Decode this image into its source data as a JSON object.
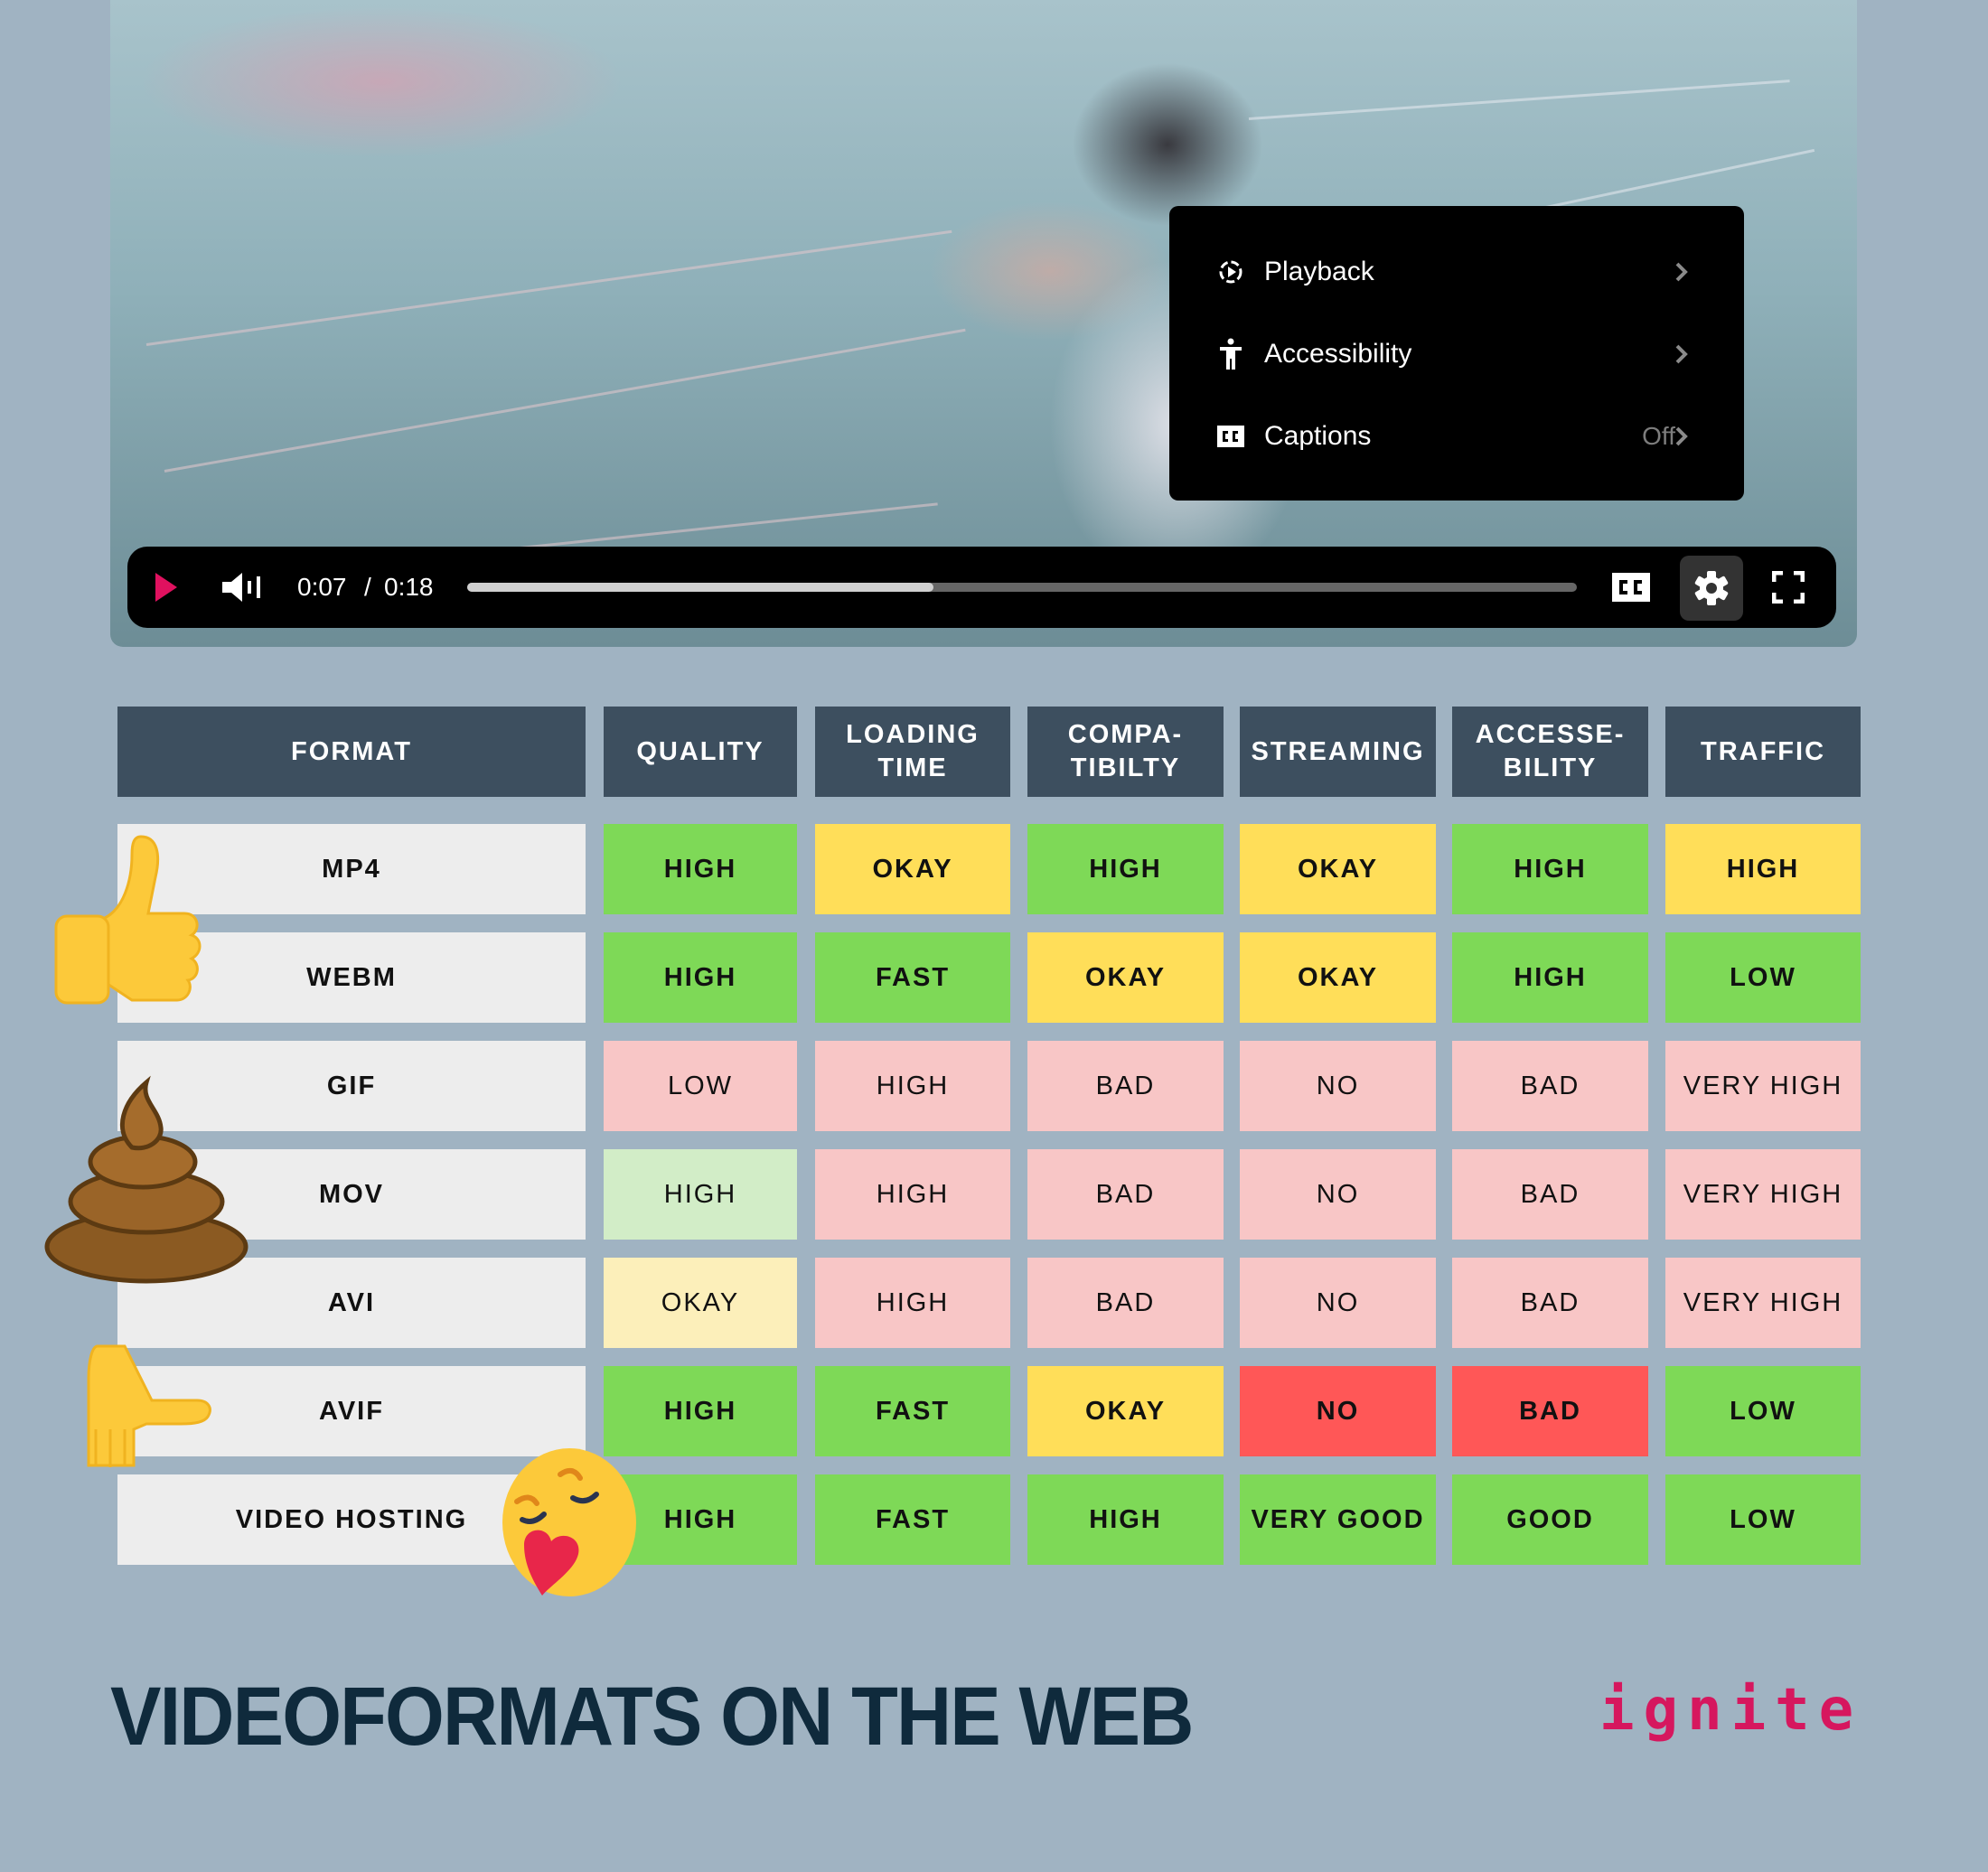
{
  "video": {
    "current_time": "0:07",
    "separator": "/",
    "duration": "0:18",
    "progress": 0.42,
    "accent_color": "#e0115f"
  },
  "settings_menu": {
    "items": [
      {
        "label": "Playback",
        "icon": "playback-icon",
        "value": ""
      },
      {
        "label": "Accessibility",
        "icon": "accessibility-icon",
        "value": ""
      },
      {
        "label": "Captions",
        "icon": "cc-icon",
        "value": "Off"
      }
    ]
  },
  "table": {
    "headers": [
      "FORMAT",
      "QUALITY",
      "LOADING\nTIME",
      "COMPA-\nTIBILTY",
      "STREAMING",
      "ACCESSE-\nBILITY",
      "TRAFFIC"
    ],
    "rows": [
      {
        "format": "MP4",
        "cells": [
          {
            "text": "HIGH",
            "color": "#7ed957",
            "bold": true
          },
          {
            "text": "OKAY",
            "color": "#ffde59",
            "bold": true
          },
          {
            "text": "HIGH",
            "color": "#7ed957",
            "bold": true
          },
          {
            "text": "OKAY",
            "color": "#ffde59",
            "bold": true
          },
          {
            "text": "HIGH",
            "color": "#7ed957",
            "bold": true
          },
          {
            "text": "HIGH",
            "color": "#ffde59",
            "bold": true
          }
        ]
      },
      {
        "format": "WEBM",
        "cells": [
          {
            "text": "HIGH",
            "color": "#7ed957",
            "bold": true
          },
          {
            "text": "FAST",
            "color": "#7ed957",
            "bold": true
          },
          {
            "text": "OKAY",
            "color": "#ffde59",
            "bold": true
          },
          {
            "text": "OKAY",
            "color": "#ffde59",
            "bold": true
          },
          {
            "text": "HIGH",
            "color": "#7ed957",
            "bold": true
          },
          {
            "text": "LOW",
            "color": "#7ed957",
            "bold": true
          }
        ]
      },
      {
        "format": "GIF",
        "cells": [
          {
            "text": "LOW",
            "color": "#f8c6c6",
            "bold": false
          },
          {
            "text": "HIGH",
            "color": "#f8c6c6",
            "bold": false
          },
          {
            "text": "BAD",
            "color": "#f8c6c6",
            "bold": false
          },
          {
            "text": "NO",
            "color": "#f8c6c6",
            "bold": false
          },
          {
            "text": "BAD",
            "color": "#f8c6c6",
            "bold": false
          },
          {
            "text": "VERY HIGH",
            "color": "#f8c6c6",
            "bold": false
          }
        ]
      },
      {
        "format": "MOV",
        "cells": [
          {
            "text": "HIGH",
            "color": "#d2edc7",
            "bold": false
          },
          {
            "text": "HIGH",
            "color": "#f8c6c6",
            "bold": false
          },
          {
            "text": "BAD",
            "color": "#f8c6c6",
            "bold": false
          },
          {
            "text": "NO",
            "color": "#f8c6c6",
            "bold": false
          },
          {
            "text": "BAD",
            "color": "#f8c6c6",
            "bold": false
          },
          {
            "text": "VERY HIGH",
            "color": "#f8c6c6",
            "bold": false
          }
        ]
      },
      {
        "format": "AVI",
        "cells": [
          {
            "text": "OKAY",
            "color": "#fcefba",
            "bold": false
          },
          {
            "text": "HIGH",
            "color": "#f8c6c6",
            "bold": false
          },
          {
            "text": "BAD",
            "color": "#f8c6c6",
            "bold": false
          },
          {
            "text": "NO",
            "color": "#f8c6c6",
            "bold": false
          },
          {
            "text": "BAD",
            "color": "#f8c6c6",
            "bold": false
          },
          {
            "text": "VERY HIGH",
            "color": "#f8c6c6",
            "bold": false
          }
        ]
      },
      {
        "format": "AVIF",
        "cells": [
          {
            "text": "HIGH",
            "color": "#7ed957",
            "bold": true
          },
          {
            "text": "FAST",
            "color": "#7ed957",
            "bold": true
          },
          {
            "text": "OKAY",
            "color": "#ffde59",
            "bold": true
          },
          {
            "text": "NO",
            "color": "#ff5757",
            "bold": true
          },
          {
            "text": "BAD",
            "color": "#ff5757",
            "bold": true
          },
          {
            "text": "LOW",
            "color": "#7ed957",
            "bold": true
          }
        ]
      },
      {
        "format": "VIDEO HOSTING",
        "cells": [
          {
            "text": "HIGH",
            "color": "#7ed957",
            "bold": true
          },
          {
            "text": "FAST",
            "color": "#7ed957",
            "bold": true
          },
          {
            "text": "HIGH",
            "color": "#7ed957",
            "bold": true
          },
          {
            "text": "VERY GOOD",
            "color": "#7ed957",
            "bold": true
          },
          {
            "text": "GOOD",
            "color": "#7ed957",
            "bold": true
          },
          {
            "text": "LOW",
            "color": "#7ed957",
            "bold": true
          }
        ]
      }
    ]
  },
  "emojis": [
    "thumbs-up-emoji",
    "poop-emoji",
    "palm-up-hand-emoji",
    "hugging-heart-face-emoji"
  ],
  "footer": {
    "title": "VIDEOFORMATS ON THE WEB",
    "logo": "ignite",
    "logo_color": "#d6175e"
  }
}
